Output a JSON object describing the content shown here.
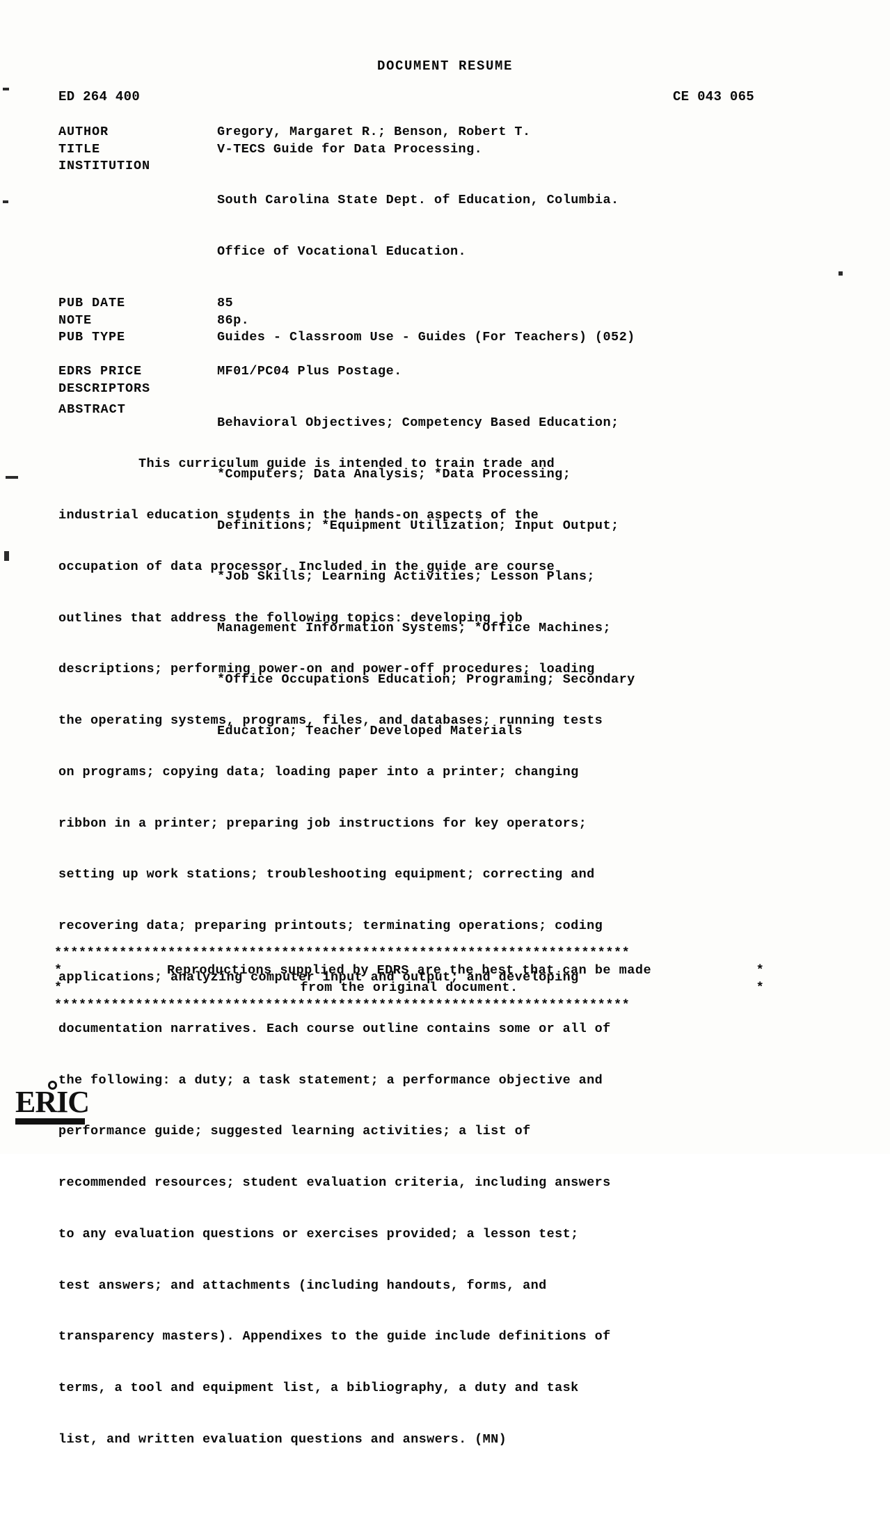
{
  "document": {
    "heading": "DOCUMENT RESUME",
    "ed_number": "ED 264 400",
    "clearinghouse_number": "CE 043 065"
  },
  "metadata": [
    {
      "label": "AUTHOR",
      "value": "Gregory, Margaret R.; Benson, Robert T."
    },
    {
      "label": "TITLE",
      "value": "V-TECS Guide for Data Processing."
    },
    {
      "label": "INSTITUTION",
      "value": "South Carolina State Dept. of Education, Columbia.",
      "continuation": "Office of Vocational Education."
    },
    {
      "label": "PUB DATE",
      "value": "85"
    },
    {
      "label": "NOTE",
      "value": "86p."
    },
    {
      "label": "PUB TYPE",
      "value": "Guides - Classroom Use - Guides (For Teachers) (052)"
    }
  ],
  "metadata2": [
    {
      "label": "EDRS PRICE",
      "value": "MF01/PC04 Plus Postage."
    },
    {
      "label": "DESCRIPTORS",
      "value": "Behavioral Objectives; Competency Based Education;",
      "lines": [
        "*Computers; Data Analysis; *Data Processing;",
        "Definitions; *Equipment Utilization; Input Output;",
        "*Job Skills; Learning Activities; Lesson Plans;",
        "Management Information Systems; *Office Machines;",
        "*Office Occupations Education; Programing; Secondary",
        "Education; Teacher Developed Materials"
      ]
    }
  ],
  "abstract": {
    "heading": "ABSTRACT",
    "lines": [
      "          This curriculum guide is intended to train trade and",
      "industrial education students in the hands-on aspects of the",
      "occupation of data processor. Included in the guide are course",
      "outlines that address the following topics: developing job",
      "descriptions; performing power-on and power-off procedures; loading",
      "the operating systems, programs, files, and databases; running tests",
      "on programs; copying data; loading paper into a printer; changing",
      "ribbon in a printer; preparing job instructions for key operators;",
      "setting up work stations; troubleshooting equipment; correcting and",
      "recovering data; preparing printouts; terminating operations; coding",
      "applications; analyzing computer input and output; and developing",
      "documentation narratives. Each course outline contains some or all of",
      "the following: a duty; a task statement; a performance objective and",
      "performance guide; suggested learning activities; a list of",
      "recommended resources; student evaluation criteria, including answers",
      "to any evaluation questions or exercises provided; a lesson test;",
      "test answers; and attachments (including handouts, forms, and",
      "transparency masters). Appendixes to the guide include definitions of",
      "terms, a tool and equipment list, a bibliography, a duty and task",
      "list, and written evaluation questions and answers. (MN)"
    ]
  },
  "footer": {
    "rule_top": "***********************************************************************",
    "rule_bottom": "***********************************************************************",
    "star": "*",
    "line1": "Reproductions supplied by EDRS are the best that can be made",
    "line2": "from the original document."
  },
  "logo": {
    "name": "ERIC",
    "text": "ERIC"
  }
}
